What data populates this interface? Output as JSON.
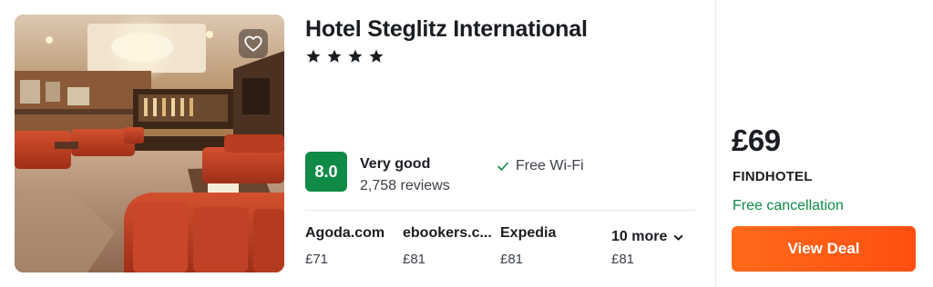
{
  "hotel": {
    "name": "Hotel Steglitz International",
    "star_count": 4,
    "stars": [
      "star",
      "star",
      "star",
      "star"
    ]
  },
  "favorite": {
    "icon": "heart-icon"
  },
  "rating": {
    "score": "8.0",
    "label": "Very good",
    "reviews": "2,758 reviews",
    "badge_color": "#0f8a47"
  },
  "amenity": {
    "label": "Free Wi-Fi",
    "icon": "checkmark-icon"
  },
  "providers": [
    {
      "name": "Agoda.com",
      "price": "£71"
    },
    {
      "name": "ebookers.c...",
      "price": "£81"
    },
    {
      "name": "Expedia",
      "price": "£81"
    }
  ],
  "more_providers": {
    "label": "10 more",
    "price": "£81",
    "icon": "chevron-down-icon"
  },
  "deal": {
    "price": "£69",
    "provider": "FINDHOTEL",
    "cancellation": "Free cancellation",
    "button_label": "View Deal",
    "button_color": "#ff5a16",
    "cancellation_color": "#0f8a47"
  }
}
